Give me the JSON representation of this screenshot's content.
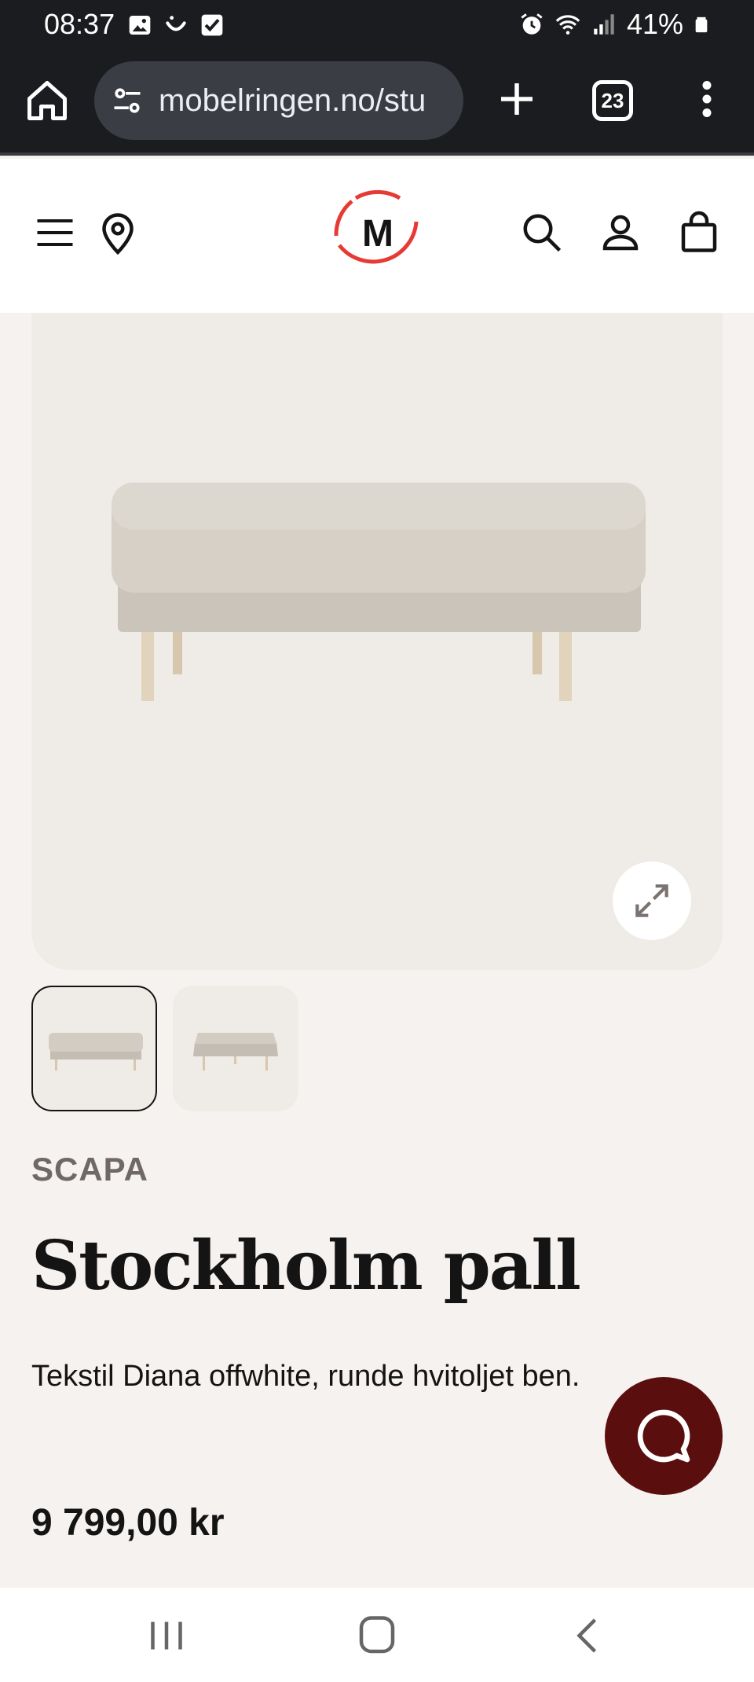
{
  "status_bar": {
    "time": "08:37",
    "battery": "41%",
    "icons_left": [
      "image-icon",
      "smile-icon",
      "check-square-icon"
    ],
    "icons_right": [
      "alarm-icon",
      "wifi-icon",
      "signal-icon",
      "battery-icon"
    ]
  },
  "browser": {
    "url": "mobelringen.no/stu",
    "tab_count": "23"
  },
  "site_header": {
    "logo_letter": "M",
    "logo_color": "#e63a35"
  },
  "product": {
    "brand": "SCAPA",
    "title": "Stockholm pall",
    "description": "Tekstil Diana offwhite, runde hvitoljet ben.",
    "price": "9 799,00 kr"
  },
  "colors": {
    "chat_button": "#5b0e0e",
    "page_background": "#f6f2ef"
  }
}
